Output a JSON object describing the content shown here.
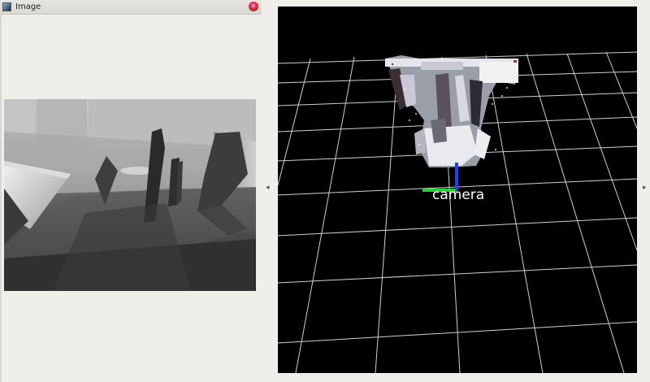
{
  "image_panel": {
    "title": "Image",
    "close_icon": "close-icon",
    "title_icon": "image-window-icon"
  },
  "render_view": {
    "frame_label": "camera",
    "background": "#000000",
    "grid_color": "#cfcfcf",
    "axis_x_color": "#2ecc40",
    "axis_z_color": "#1f3fff"
  },
  "splitter": {
    "left_arrow": "◂",
    "right_arrow": "▸"
  }
}
